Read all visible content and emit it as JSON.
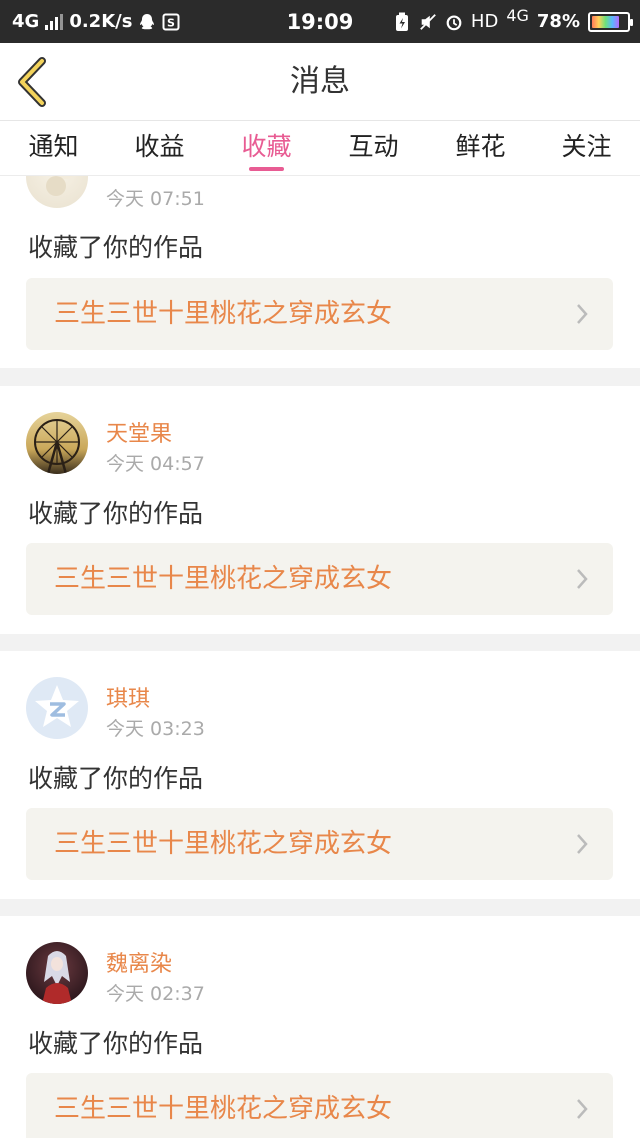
{
  "status_bar": {
    "network": "4G",
    "speed": "0.2K/s",
    "time": "19:09",
    "hd": "HD",
    "net_right": "4G",
    "battery": "78%",
    "icons": [
      "signal-icon",
      "qq-icon",
      "s-app-icon",
      "battery-saver-icon",
      "mute-icon",
      "alarm-icon",
      "battery-icon"
    ]
  },
  "header": {
    "title": "消息",
    "back_icon": "chevron-left-icon"
  },
  "tabs": [
    {
      "label": "通知",
      "active": false
    },
    {
      "label": "收益",
      "active": false
    },
    {
      "label": "收藏",
      "active": true
    },
    {
      "label": "互动",
      "active": false
    },
    {
      "label": "鲜花",
      "active": false
    },
    {
      "label": "关注",
      "active": false
    }
  ],
  "colors": {
    "accent": "#e85c93",
    "name": "#e8874a",
    "link_bg": "#f4f3ee"
  },
  "items": [
    {
      "user": "",
      "time": "今天 07:51",
      "action": "收藏了你的作品",
      "work": "三生三世十里桃花之穿成玄女"
    },
    {
      "user": "天堂果",
      "time": "今天 04:57",
      "action": "收藏了你的作品",
      "work": "三生三世十里桃花之穿成玄女"
    },
    {
      "user": "琪琪",
      "time": "今天 03:23",
      "action": "收藏了你的作品",
      "work": "三生三世十里桃花之穿成玄女"
    },
    {
      "user": "魏离染",
      "time": "今天 02:37",
      "action": "收藏了你的作品",
      "work": "三生三世十里桃花之穿成玄女"
    }
  ]
}
